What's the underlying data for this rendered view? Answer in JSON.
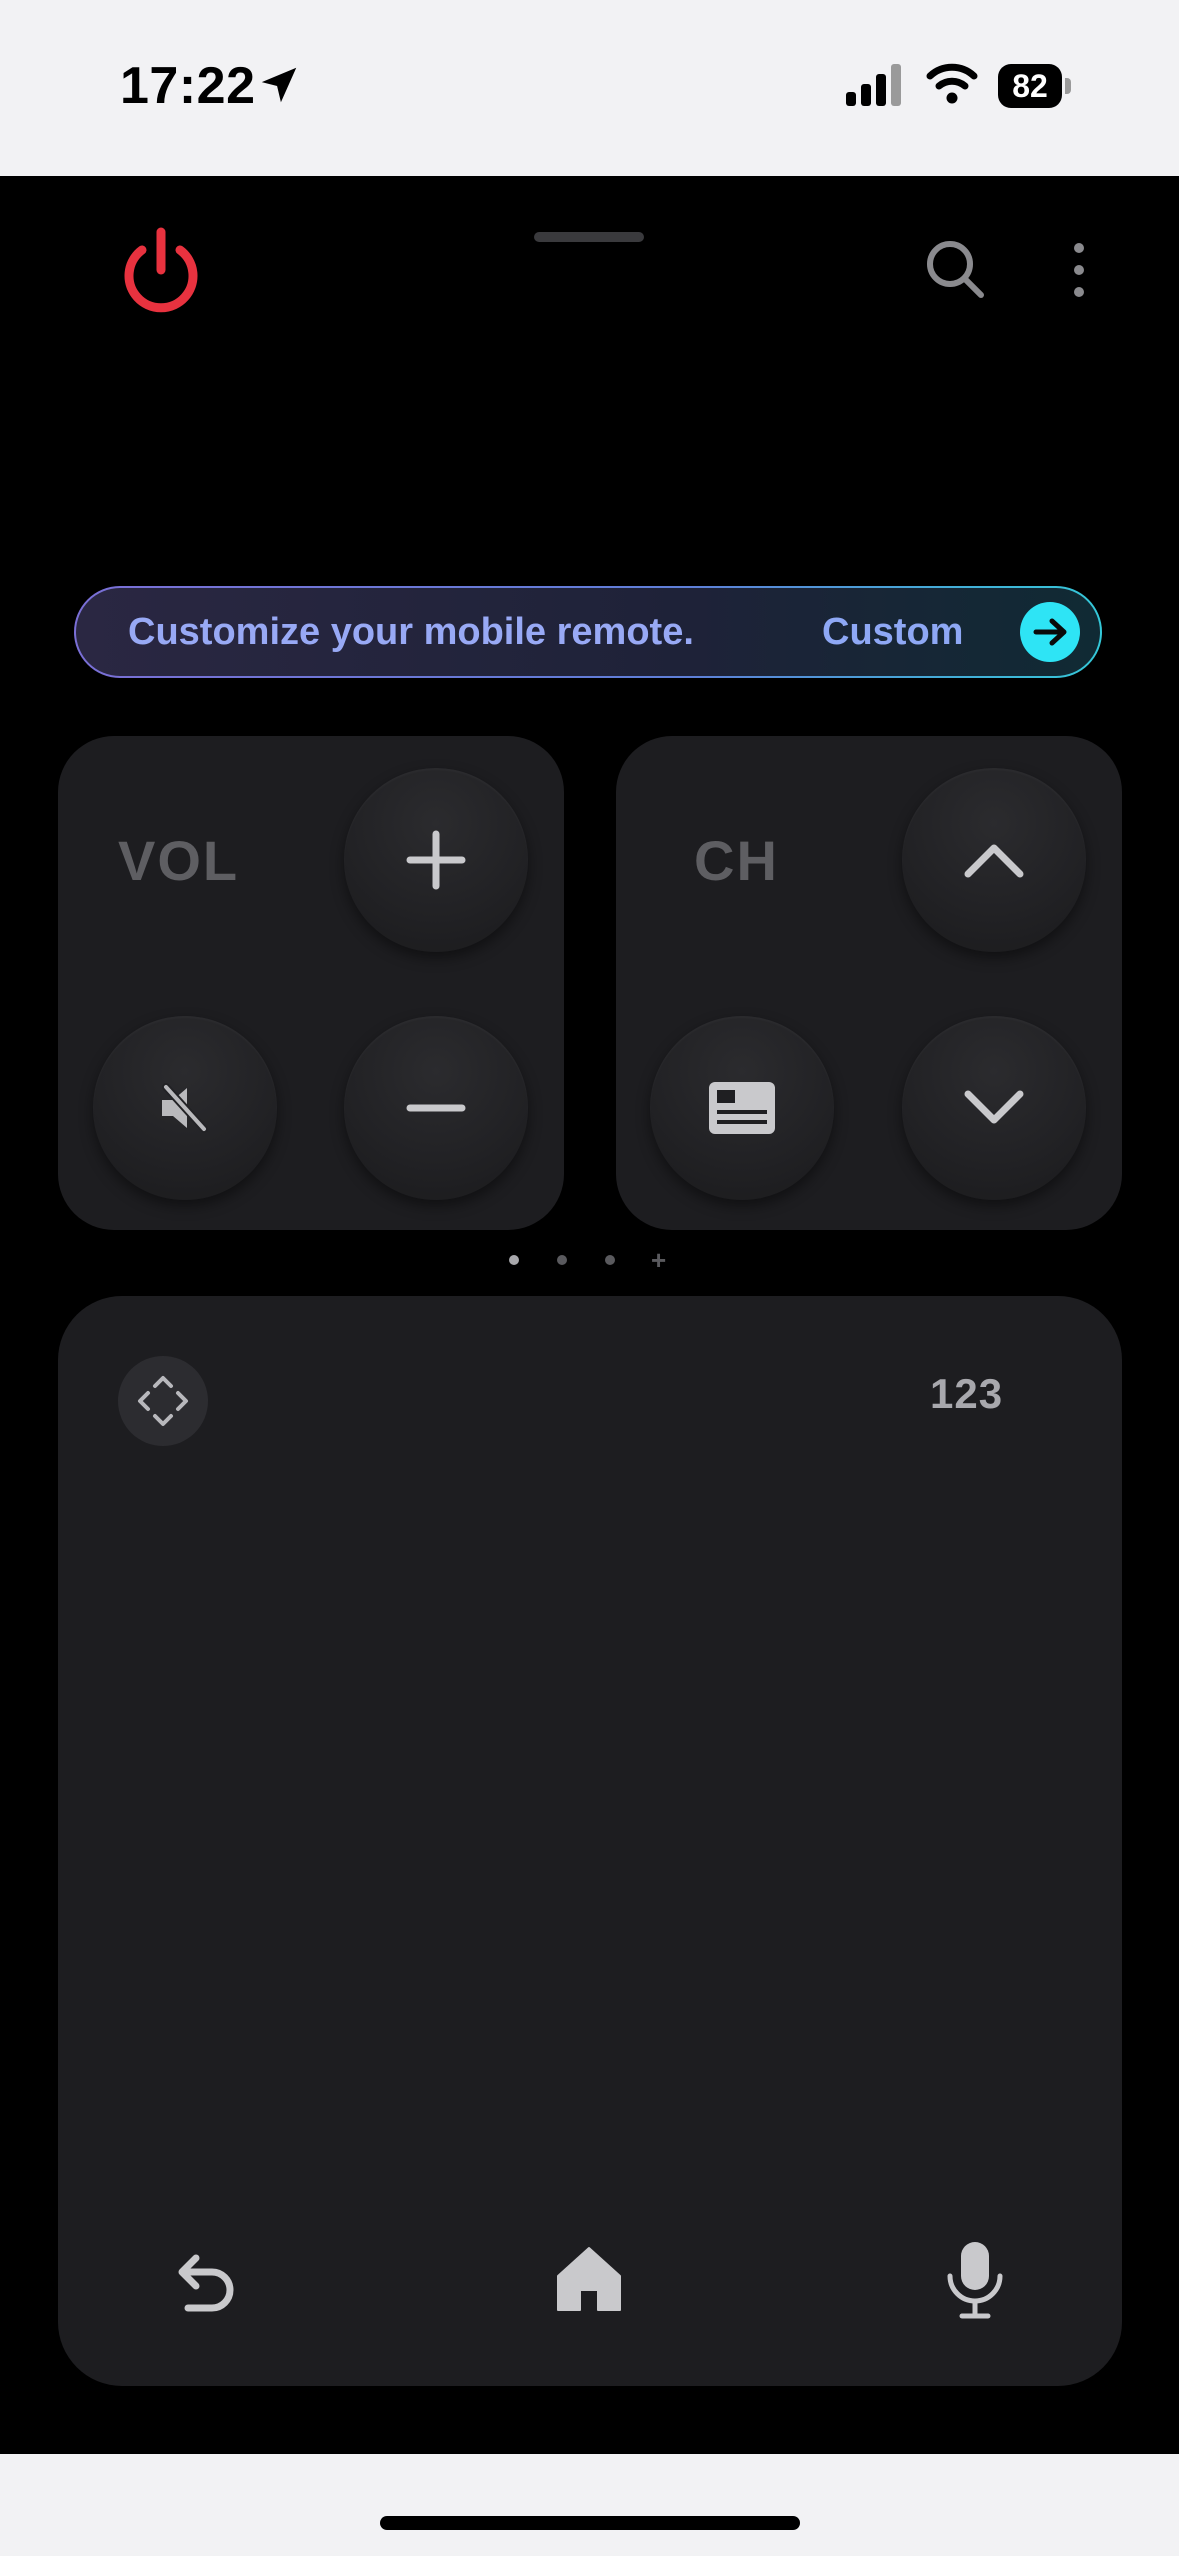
{
  "status_bar": {
    "time": "17:22",
    "battery": "82",
    "icons": [
      "location-arrow-icon",
      "cellular-signal-icon",
      "wifi-icon",
      "battery-icon"
    ]
  },
  "header": {
    "icons": [
      "power-icon",
      "search-icon",
      "more-vertical-icon"
    ],
    "colors": {
      "power": "#e8323f"
    }
  },
  "banner": {
    "text": "Customize your mobile remote.",
    "text_repeat": "Custom",
    "icon": "arrow-right-icon",
    "colors": {
      "arrow_bg": "#2ee4f5",
      "text": "#98a9f5"
    }
  },
  "volume": {
    "label": "VOL",
    "icons": [
      "plus-icon",
      "mute-icon",
      "minus-icon"
    ]
  },
  "channel": {
    "label": "CH",
    "icons": [
      "chevron-up-icon",
      "guide-icon",
      "chevron-down-icon"
    ]
  },
  "pager": {
    "dots": 3,
    "active_index": 0,
    "add_symbol": "+"
  },
  "touchpad": {
    "number_label": "123",
    "icons": [
      "move-arrows-icon",
      "back-icon",
      "home-icon",
      "microphone-icon"
    ]
  }
}
